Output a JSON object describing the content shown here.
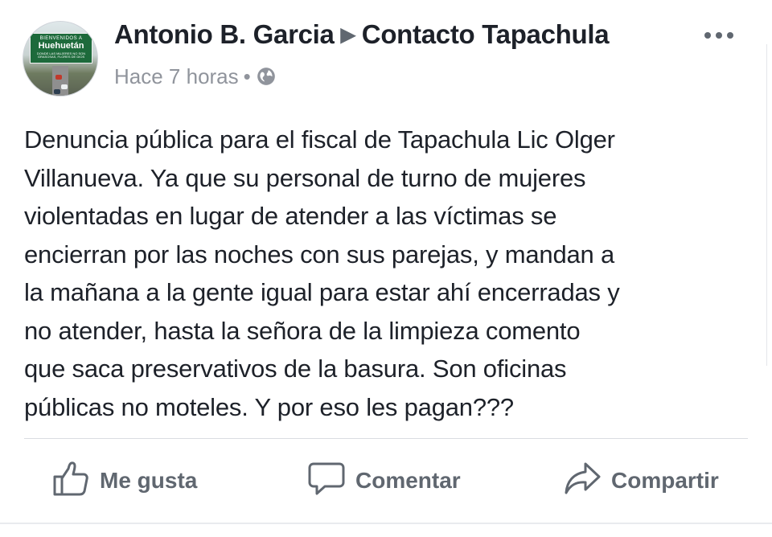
{
  "post": {
    "author": "Antonio B. Garcia",
    "arrow": "▶",
    "group": "Contacto Tapachula",
    "time": "Hace 7 horas",
    "dot": "•",
    "privacy_icon": "globe-icon",
    "avatar_sign": {
      "line1": "BIENVENIDOS A",
      "line2": "Huehuetán",
      "line3": "DONDE LAS MUJERES NO SON GRASOSAS, FLORES DE DIOS"
    },
    "text_lines": [
      "Denuncia pública para el fiscal de Tapachula Lic Olger",
      "Villanueva. Ya que su personal de turno de mujeres",
      "violentadas en lugar  de atender a las víctimas se",
      "encierran por las noches con sus parejas, y mandan a",
      "la mañana a la gente igual para estar ahí encerradas y",
      "no atender, hasta la señora de la limpieza comento",
      "que saca preservativos de la basura. Son oficinas",
      "públicas no moteles. Y por eso les pagan???"
    ]
  },
  "actions": {
    "like": "Me gusta",
    "comment": "Comentar",
    "share": "Compartir"
  },
  "colors": {
    "text": "#1d2129",
    "muted": "#90949c",
    "action": "#606770",
    "divider": "#dadde1"
  }
}
